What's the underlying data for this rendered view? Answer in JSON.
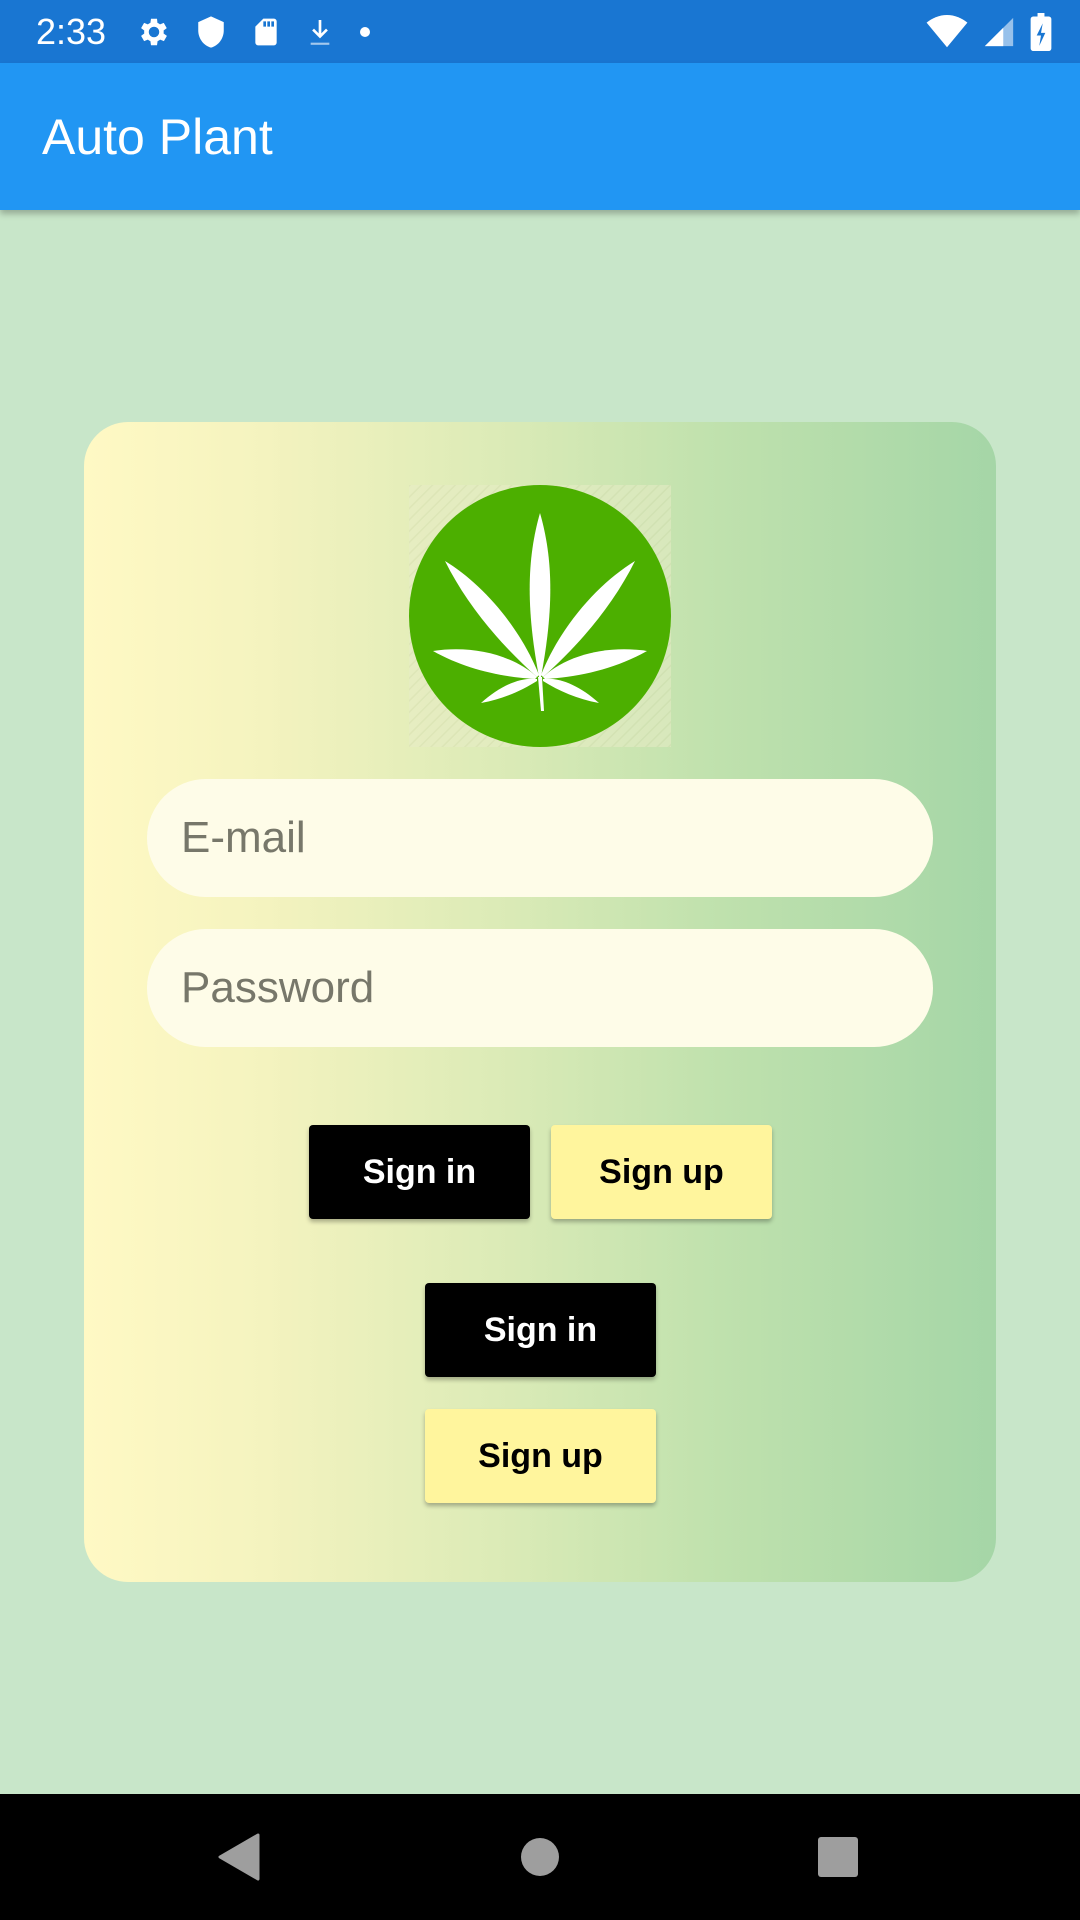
{
  "status_bar": {
    "time": "2:33",
    "icons_left": [
      "settings-icon",
      "shield-icon",
      "sd-card-icon",
      "download-icon",
      "dot-icon"
    ],
    "icons_right": [
      "wifi-icon",
      "signal-icon",
      "battery-charging-icon"
    ],
    "color": "#1976d2"
  },
  "app_bar": {
    "title": "Auto Plant",
    "color": "#2196f3"
  },
  "login": {
    "logo": "cannabis-leaf-logo",
    "email_placeholder": "E-mail",
    "password_placeholder": "Password",
    "buttons_row": {
      "sign_in": "Sign in",
      "sign_up": "Sign up"
    },
    "buttons_stack": {
      "sign_in": "Sign in",
      "sign_up": "Sign up"
    }
  },
  "nav_bar": {
    "icons": [
      "back-icon",
      "home-icon",
      "recents-icon"
    ]
  },
  "colors": {
    "background": "#c8e6c9",
    "button_dark": "#000000",
    "button_light": "#fff59d",
    "field_bg": "#fefce8",
    "logo_green": "#4caf00"
  }
}
